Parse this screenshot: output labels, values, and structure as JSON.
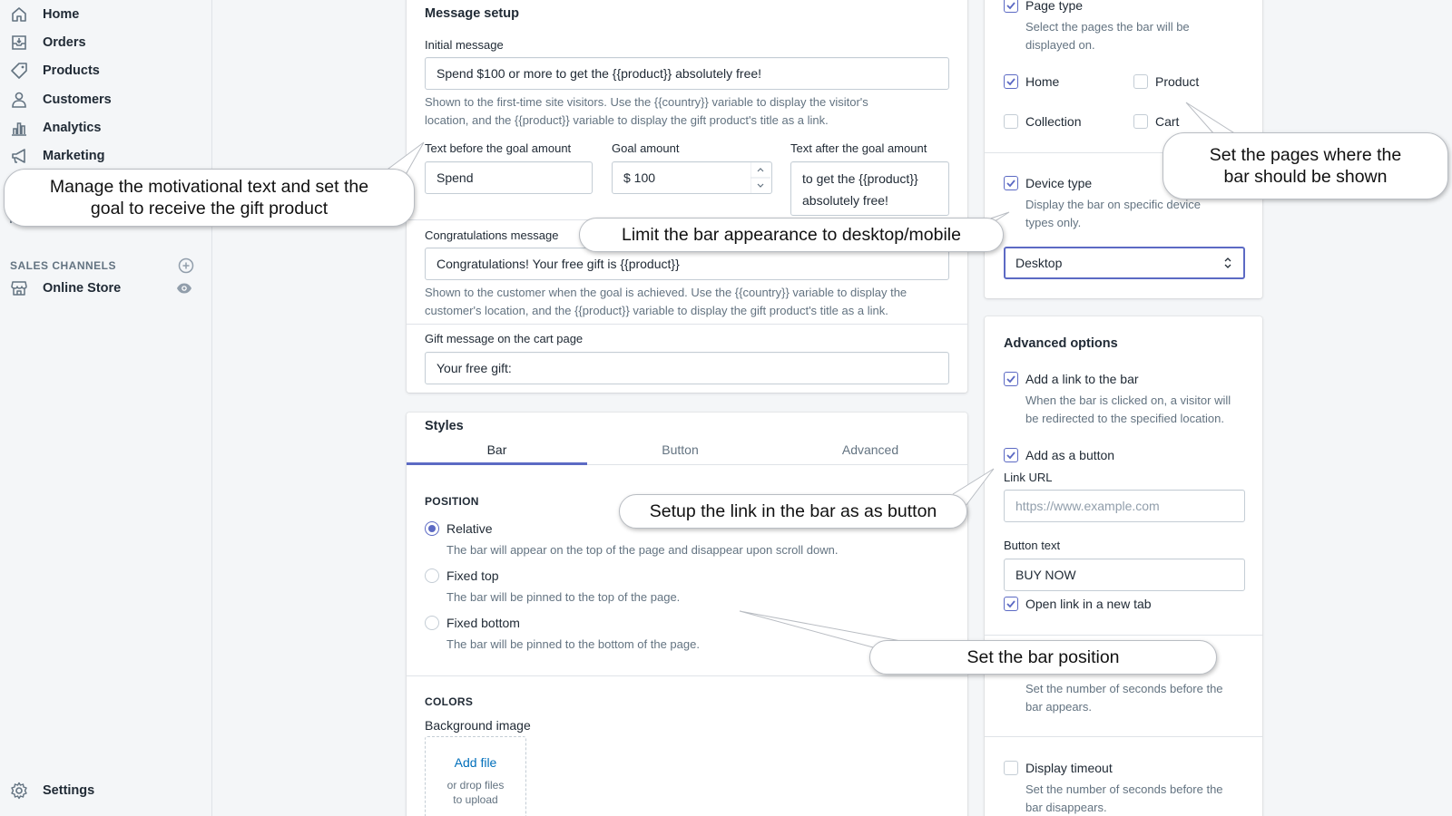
{
  "sidebar": {
    "items": [
      {
        "label": "Home",
        "icon": "home-icon"
      },
      {
        "label": "Orders",
        "icon": "orders-icon"
      },
      {
        "label": "Products",
        "icon": "tag-icon"
      },
      {
        "label": "Customers",
        "icon": "person-icon"
      },
      {
        "label": "Analytics",
        "icon": "analytics-icon"
      },
      {
        "label": "Marketing",
        "icon": "megaphone-icon"
      }
    ],
    "sales_channels_heading": "SALES CHANNELS",
    "online_store": "Online Store",
    "settings": "Settings"
  },
  "message_setup": {
    "title": "Message setup",
    "initial_label": "Initial message",
    "initial_value": "Spend $100 or more to get the {{product}} absolutely free!",
    "initial_help_1": "Shown to the first-time site visitors. Use the {{country}} variable to display the visitor's",
    "initial_help_2": "location, and the {{product}} variable to display the gift product's title as a link.",
    "before_label": "Text before the goal amount",
    "before_value": "Spend",
    "goal_label": "Goal amount",
    "goal_value": "$ 100",
    "after_label": "Text after the goal amount",
    "after_value_1": "to get the {{product}}",
    "after_value_2": "absolutely free!",
    "congrats_label": "Congratulations message",
    "congrats_value": "Congratulations! Your free gift is {{product}}",
    "congrats_help_1": "Shown to the customer when the goal is achieved. Use the {{country}} variable to display the",
    "congrats_help_2": "customer's location, and the {{product}} variable to display the gift product's title as a link.",
    "gift_label": "Gift message on the cart page",
    "gift_value": "Your free gift:"
  },
  "styles": {
    "title": "Styles",
    "tabs": [
      "Bar",
      "Button",
      "Advanced"
    ],
    "position_heading": "POSITION",
    "positions": [
      {
        "label": "Relative",
        "help": "The bar will appear on the top of the page and disappear upon scroll down."
      },
      {
        "label": "Fixed top",
        "help": "The bar will be pinned to the top of the page."
      },
      {
        "label": "Fixed bottom",
        "help": "The bar will be pinned to the bottom of the page."
      }
    ],
    "selected_position": "Relative",
    "colors_heading": "COLORS",
    "bg_image_label": "Background image",
    "add_file": "Add file",
    "drop_help_1": "or drop files",
    "drop_help_2": "to upload"
  },
  "display": {
    "page_type_label": "Page type",
    "page_type_help_1": "Select the pages the bar will be",
    "page_type_help_2": "displayed on.",
    "pages": {
      "home": "Home",
      "product": "Product",
      "collection": "Collection",
      "cart": "Cart"
    },
    "device_type_label": "Device type",
    "device_help_1": "Display the bar on specific device",
    "device_help_2": "types only.",
    "device_selected": "Desktop"
  },
  "advanced": {
    "title": "Advanced options",
    "add_link_label": "Add a link to the bar",
    "add_link_help_1": "When the bar is clicked on, a visitor will",
    "add_link_help_2": "be redirected to the specified location.",
    "as_button_label": "Add as a button",
    "link_url_label": "Link URL",
    "link_url_placeholder": "https://www.example.com",
    "button_text_label": "Button text",
    "button_text_value": "BUY NOW",
    "new_tab_label": "Open link in a new tab",
    "delay_help_1": "Set the number of seconds before the",
    "delay_help_2": "bar appears.",
    "timeout_label": "Display timeout",
    "timeout_help_1": "Set the number of seconds before the",
    "timeout_help_2": "bar disappears."
  },
  "callouts": {
    "motivational_1": "Manage the motivational text and set the",
    "motivational_2": "goal to receive the gift product",
    "device": "Limit the bar appearance to desktop/mobile",
    "pages_1": "Set the pages where the",
    "pages_2": "bar should be shown",
    "link_button": "Setup the link in the bar as as button",
    "position": "Set the bar position"
  },
  "colors": {
    "accent": "#5c6ac4",
    "link": "#006fbb"
  }
}
